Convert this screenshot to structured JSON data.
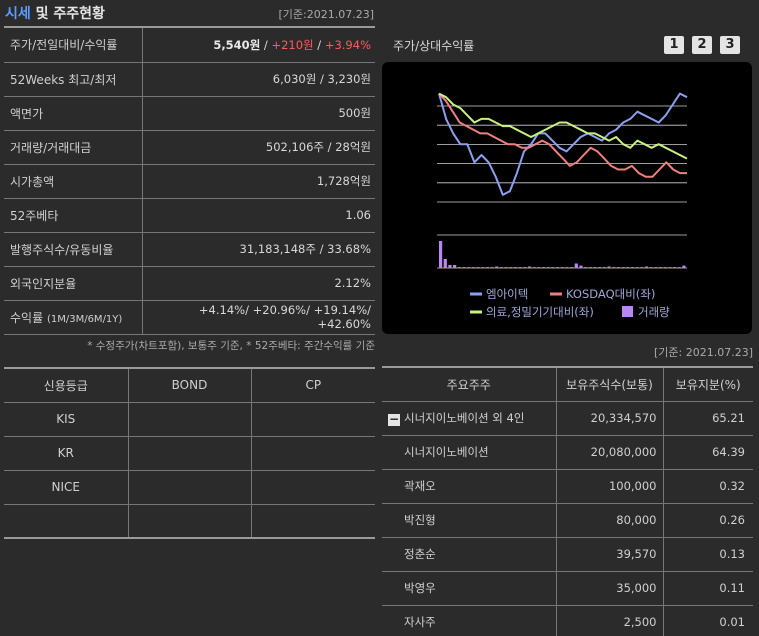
{
  "header": {
    "title_a": "시세",
    "title_b": " 및 주주현황",
    "date": "[기준:2021.07.23]"
  },
  "info_rows": [
    {
      "key": "주가/전일대비/수익률",
      "v1": "5,540원",
      "v2": "+210원",
      "v3": "+3.94%"
    },
    {
      "key": "52Weeks 최고/최저",
      "value": "6,030원 / 3,230원"
    },
    {
      "key": "액면가",
      "value": "500원"
    },
    {
      "key": "거래량/거래대금",
      "value": "502,106주 / 28억원"
    },
    {
      "key": "시가총액",
      "value": "1,728억원"
    },
    {
      "key": "52주베타",
      "value": "1.06"
    },
    {
      "key": "발행주식수/유동비율",
      "value": "31,183,148주 / 33.68%"
    },
    {
      "key": "외국인지분율",
      "value": "2.12%"
    },
    {
      "key": "수익률",
      "key_sub": "(1M/3M/6M/1Y)",
      "value": "+4.14%/ +20.96%/ +19.14%/ +42.60%"
    }
  ],
  "note": "* 수정주가(차트포함), 보통주 기준, * 52주베타: 주간수익률 기준",
  "credit": {
    "headers": [
      "신용등급",
      "BOND",
      "CP"
    ],
    "rows": [
      [
        "KIS",
        "",
        ""
      ],
      [
        "KR",
        "",
        ""
      ],
      [
        "NICE",
        "",
        ""
      ],
      [
        "",
        "",
        ""
      ]
    ]
  },
  "chart_section": {
    "title": "주가/상대수익률",
    "tabs": [
      "1",
      "2",
      "3"
    ]
  },
  "chart_data": {
    "type": "line",
    "x": [
      1,
      2,
      3,
      4,
      5,
      6,
      7,
      8,
      9,
      10,
      11,
      12,
      13,
      14,
      15,
      16,
      17,
      18,
      19,
      20,
      21,
      22,
      23,
      24,
      25,
      26,
      27,
      28,
      29,
      30,
      31,
      32,
      33,
      34,
      35,
      36,
      37,
      38,
      39,
      40,
      41,
      42,
      43,
      44,
      45,
      46,
      47,
      48,
      49,
      50,
      51,
      52,
      53
    ],
    "series": [
      {
        "name": "엠아이텍",
        "color": "#8ca0f0",
        "axis": "left",
        "values": [
          100,
          93,
          89,
          86,
          86,
          81,
          83,
          81,
          77,
          72,
          73,
          78,
          84,
          86,
          89,
          89,
          87,
          85,
          84,
          86,
          88,
          89,
          88,
          87,
          89,
          90,
          92,
          93,
          95,
          94,
          93,
          92,
          94,
          97,
          100,
          99
        ]
      },
      {
        "name": "KOSDAQ대비(좌)",
        "color": "#f08080",
        "axis": "left",
        "values": [
          100,
          98,
          95,
          92,
          91,
          90,
          89,
          89,
          88,
          87,
          86,
          86,
          85,
          85,
          86,
          87,
          86,
          84,
          82,
          80,
          81,
          83,
          85,
          84,
          82,
          80,
          79,
          79,
          80,
          78,
          77,
          77,
          79,
          81,
          79,
          78,
          78
        ]
      },
      {
        "name": "의료,정밀기기대비(좌)",
        "color": "#c8f080",
        "axis": "left",
        "values": [
          100,
          99,
          97,
          96,
          94,
          92,
          93,
          93,
          92,
          91,
          91,
          90,
          89,
          88,
          89,
          90,
          91,
          92,
          92,
          91,
          90,
          89,
          89,
          88,
          87,
          88,
          86,
          85,
          87,
          86,
          85,
          86,
          85,
          84,
          83,
          82
        ]
      },
      {
        "name": "거래량",
        "color": "#b888f0",
        "axis": "right",
        "type": "bar",
        "values": [
          9,
          3,
          1,
          1,
          0.3,
          0.3,
          0.3,
          0.3,
          0.3,
          0.3,
          0.3,
          0.3,
          0.5,
          0.3,
          0.3,
          0.3,
          0.3,
          0.3,
          0.3,
          0.5,
          0.3,
          0.3,
          0.3,
          0.3,
          0.3,
          0.3,
          0.3,
          0.3,
          0.3,
          1.5,
          0.8,
          0.3,
          0.3,
          0.3,
          0.3,
          0.3,
          0.5,
          0.3,
          0.3,
          0.3,
          0.3,
          0.3,
          0.3,
          0.3,
          0.5,
          0.3,
          0.3,
          0.3,
          0.3,
          0.3,
          0.3,
          0.3,
          0.8
        ]
      }
    ],
    "ylim": [
      70,
      101
    ],
    "legend_position": "bottom"
  },
  "holders": {
    "date": "[기준: 2021.07.23]",
    "headers": [
      "주요주주",
      "보유주식수(보통)",
      "보유지분(%)"
    ],
    "rows": [
      {
        "name": "시너지이노베이션 외 4인",
        "shares": "20,334,570",
        "pct": "65.21",
        "group": true
      },
      {
        "name": "시너지이노베이션",
        "shares": "20,080,000",
        "pct": "64.39"
      },
      {
        "name": "곽재오",
        "shares": "100,000",
        "pct": "0.32"
      },
      {
        "name": "박진형",
        "shares": "80,000",
        "pct": "0.26"
      },
      {
        "name": "정춘순",
        "shares": "39,570",
        "pct": "0.13"
      },
      {
        "name": "박영우",
        "shares": "35,000",
        "pct": "0.11"
      },
      {
        "name": "자사주",
        "shares": "2,500",
        "pct": "0.01"
      }
    ]
  }
}
